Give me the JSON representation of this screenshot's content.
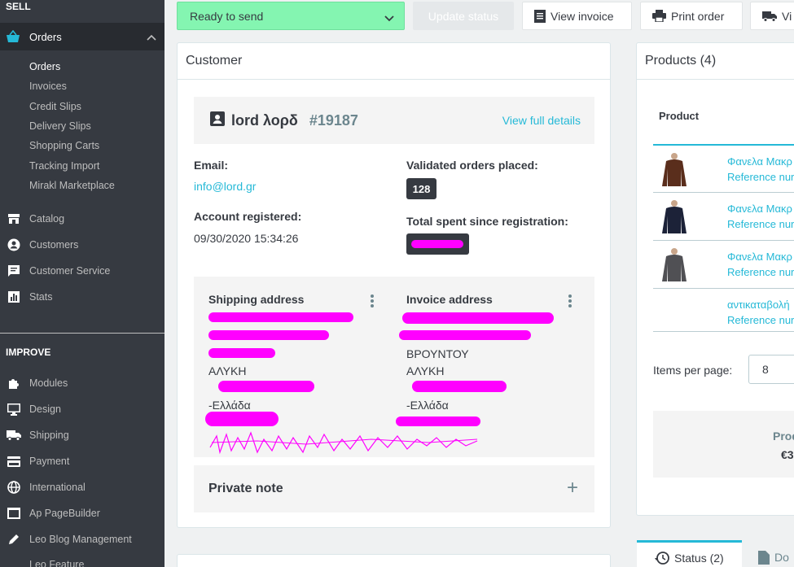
{
  "sidebar": {
    "sell_label": "SELL",
    "orders_label": "Orders",
    "sub_items": [
      "Orders",
      "Invoices",
      "Credit Slips",
      "Delivery Slips",
      "Shopping Carts",
      "Tracking Import",
      "Mirakl Marketplace"
    ],
    "items": [
      "Catalog",
      "Customers",
      "Customer Service",
      "Stats"
    ],
    "improve_label": "IMPROVE",
    "improve_items": [
      "Modules",
      "Design",
      "Shipping",
      "Payment",
      "International",
      "Ap PageBuilder",
      "Leo Blog Management",
      "Leo Feature"
    ]
  },
  "toolbar": {
    "status_value": "Ready to send",
    "update_label": "Update status",
    "view_invoice_label": "View invoice",
    "print_order_label": "Print order",
    "view_label": "Vi"
  },
  "customer": {
    "title": "Customer",
    "name": "lord λορδ",
    "id": "#19187",
    "view_details": "View full details",
    "email_label": "Email:",
    "email_value": "info@lord.gr",
    "validated_label": "Validated orders placed:",
    "validated_value": "128",
    "registered_label": "Account registered:",
    "registered_value": "09/30/2020 15:34:26",
    "total_spent_label": "Total spent since registration:",
    "shipping_title": "Shipping address",
    "invoice_title": "Invoice address",
    "shipping_lines": [
      "ΑΛΥΚΗ",
      "-Ελλάδα"
    ],
    "invoice_lines": [
      "ΒΡΟΥΝΤΟΥ",
      "ΑΛΥΚΗ",
      "-Ελλάδα"
    ],
    "private_note": "Private note",
    "plus": "+"
  },
  "products": {
    "title": "Products (4)",
    "col_product": "Product",
    "rows": [
      {
        "name": "Φανελα Μακρ",
        "ref": "Reference nur",
        "color": "#5a2e1c"
      },
      {
        "name": "Φανελα Μακρ",
        "ref": "Reference nur",
        "color": "#1c2238"
      },
      {
        "name": "Φανελα Μακρ",
        "ref": "Reference nur",
        "color": "#505054"
      },
      {
        "name": "αντικαταβολή",
        "ref": "Reference nur",
        "color": ""
      }
    ],
    "items_per_page_label": "Items per page:",
    "items_per_page_value": "8",
    "totals_label": "Prod",
    "totals_value": "€3"
  },
  "tabs": {
    "status_label": "Status (2)",
    "documents_label": "Do"
  },
  "colors": {
    "accent": "#25b9d7",
    "status_green": "#84f5b1",
    "sidebar_bg": "#363a41",
    "redaction": "#ff00ff"
  }
}
